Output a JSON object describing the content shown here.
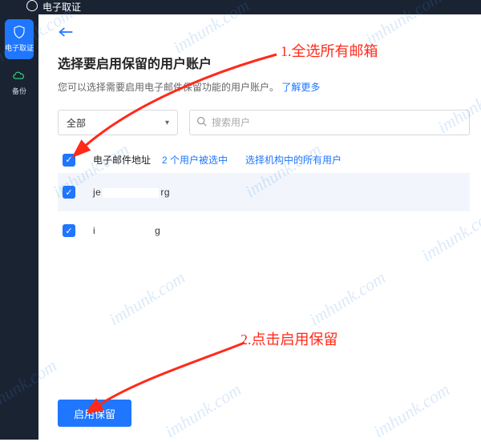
{
  "app": {
    "title": "电子取证"
  },
  "sidebar": {
    "items": [
      {
        "label": "电子取证",
        "icon": "shield-icon",
        "active": true
      },
      {
        "label": "备份",
        "icon": "cloud-icon",
        "active": false
      }
    ]
  },
  "page": {
    "title": "选择要启用保留的用户账户",
    "subtitle_prefix": "您可以选择需要启用电子邮件保留功能的用户账户。",
    "learn_more": "了解更多"
  },
  "filters": {
    "select_value": "全部",
    "search_placeholder": "搜索用户"
  },
  "table": {
    "column_label": "电子邮件地址",
    "selected_count_text": "2 个用户被选中",
    "select_all_org_text": "选择机构中的所有用户",
    "rows": [
      {
        "checked": true,
        "email_prefix": "je",
        "email_suffix": "rg"
      },
      {
        "checked": true,
        "email_prefix": "i",
        "email_suffix": "g"
      }
    ]
  },
  "actions": {
    "primary": "启用保留"
  },
  "annotations": {
    "a1": "1.全选所有邮箱",
    "a2": "2.点击启用保留"
  },
  "watermark": "imhunk.com"
}
